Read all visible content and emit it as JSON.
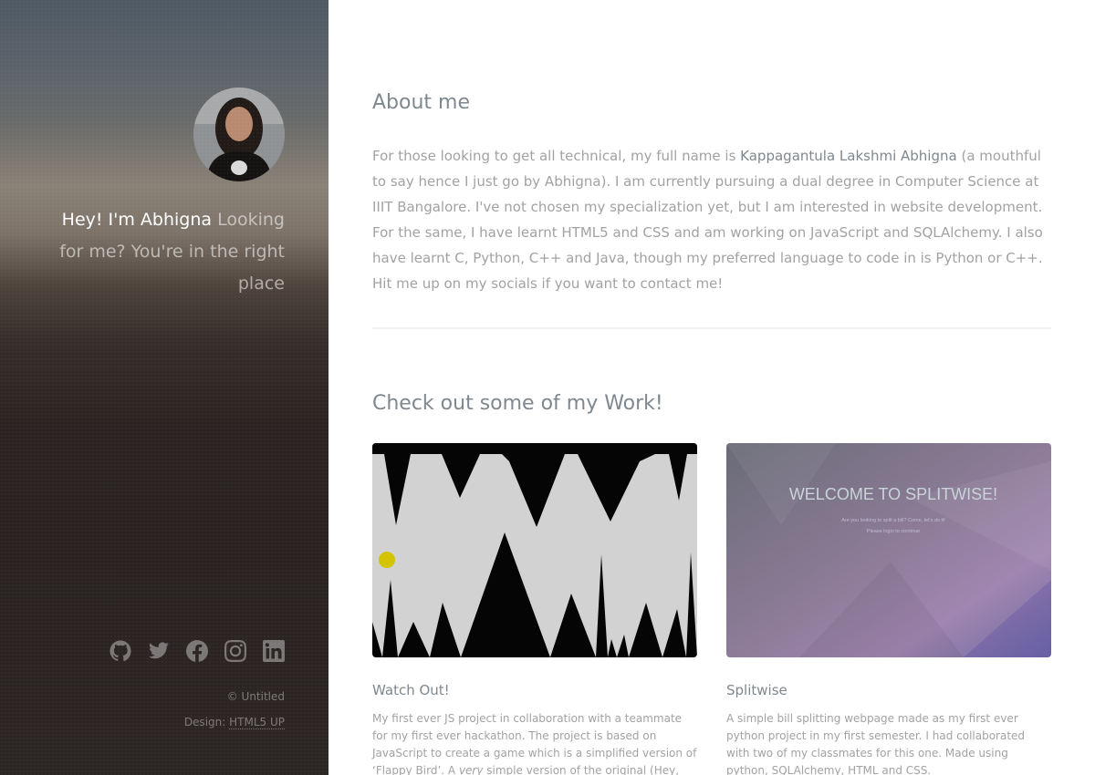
{
  "sidebar": {
    "greeting_name": "Hey! I'm Abhigna",
    "greeting_rest": "Looking for me? You're in the right place",
    "social_icons": [
      "github-icon",
      "twitter-icon",
      "facebook-icon",
      "instagram-icon",
      "linkedin-icon"
    ],
    "copyright": "© Untitled",
    "design_label": "Design:",
    "design_link": "HTML5 UP"
  },
  "about": {
    "title": "About me",
    "text_before": "For those looking to get all technical, my full name is ",
    "full_name": "Kappagantula Lakshmi Abhigna",
    "text_after": " (a mouthful to say hence I just go by Abhigna). I am currently pursuing a dual degree in Computer Science at IIIT Bangalore. I've not chosen my specialization yet, but I am interested in website development. For the same, I have learnt HTML5 and CSS and am working on JavaScript and SQLAlchemy. I also have learnt C, Python, C++ and Java, though my preferred language to code in is Python or C++. Hit me up on my socials if you want to contact me!"
  },
  "work": {
    "title": "Check out some of my Work!",
    "projects": [
      {
        "title": "Watch Out!",
        "desc_before": "My first ever JS project in collaboration with a teammate for my first ever hackathon. The project is based on JavaScript to create a game which is a simplified version of ‘Flappy Bird’. A ",
        "desc_em": "very",
        "desc_after": " simple version of the original (Hey, don't judge me! It was my first"
      },
      {
        "title": "Splitwise",
        "thumb_heading": "WELCOME TO SPLITWISE!",
        "thumb_line1": "Are you looking to split a bill? Come, let's do it!",
        "thumb_line2": "Please login to continue",
        "desc": "A simple bill splitting webpage made as my first ever python project in my first semester. I had collaborated with two of my classmates for this one. Made using python, SQLAlchemy, HTML and CSS."
      }
    ]
  },
  "colors": {
    "heading": "#7f888f",
    "body_text": "#a2a2a2",
    "divider": "#efefef"
  }
}
